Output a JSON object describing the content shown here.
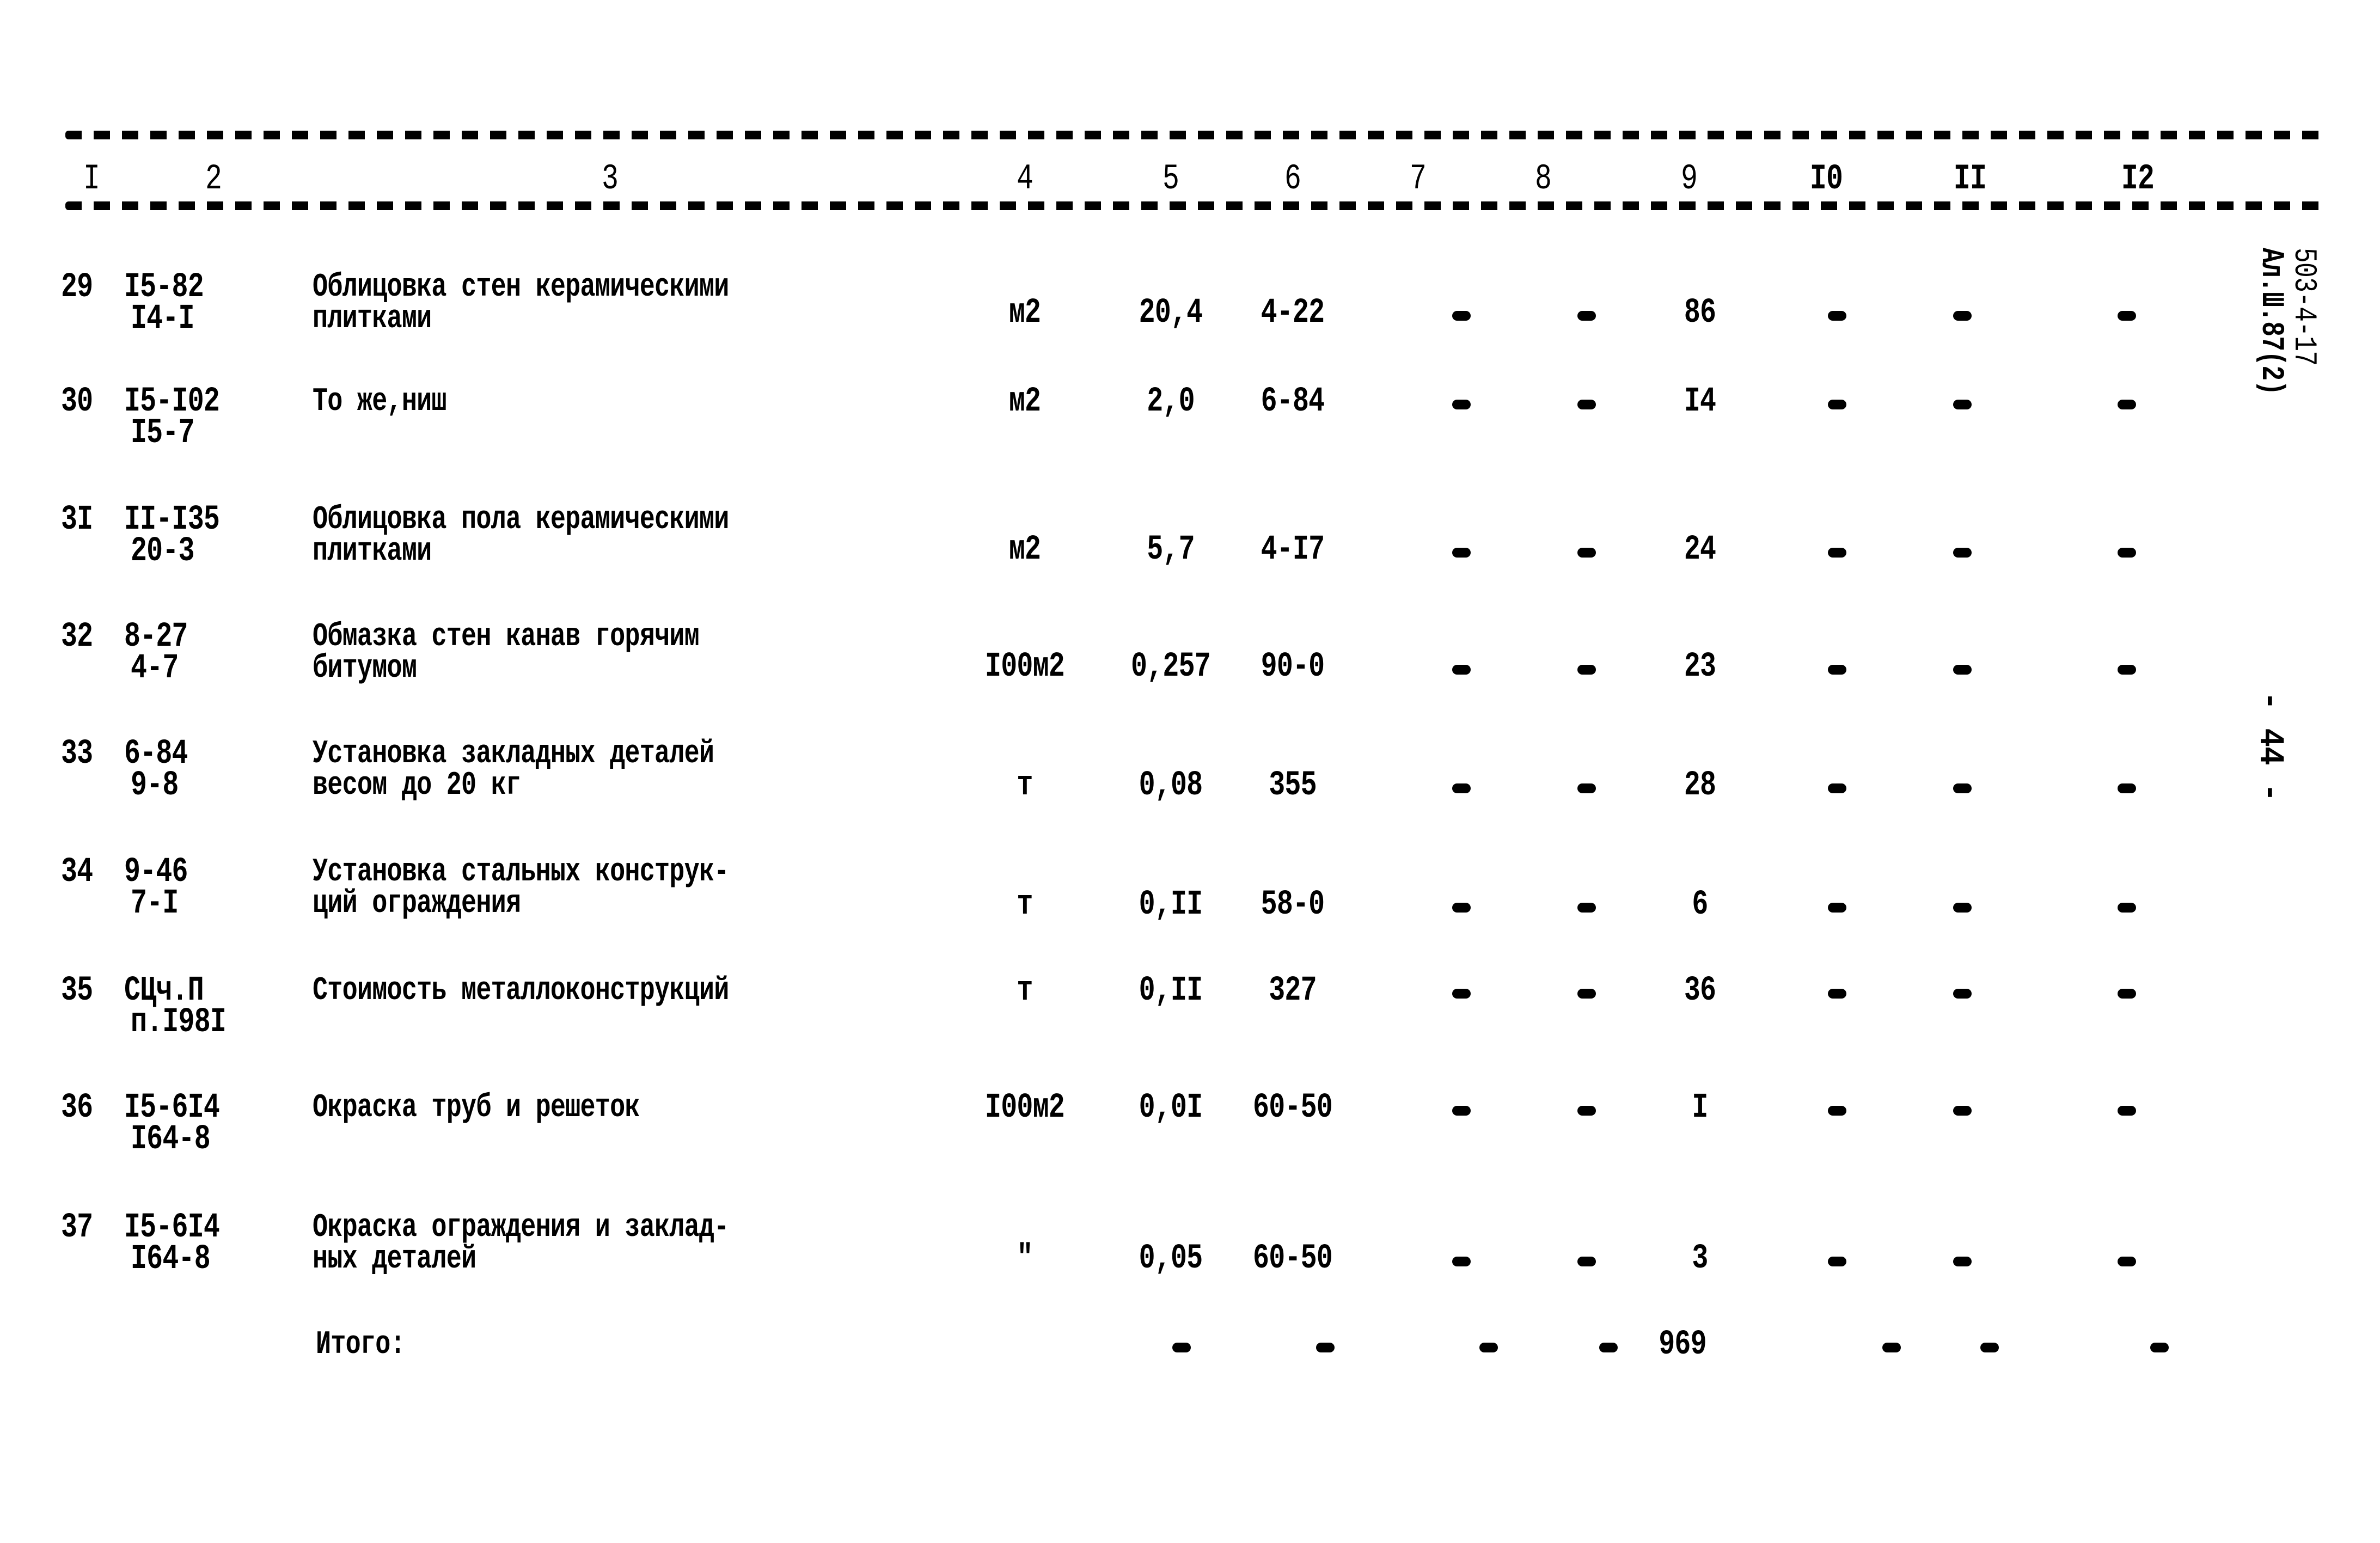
{
  "document": {
    "side_code_line1": "503-4-17",
    "side_code_line2": "Ал.Ш.87(2)",
    "page_number": "- 44 -"
  },
  "table": {
    "column_headers": [
      "I",
      "2",
      "3",
      "4",
      "5",
      "6",
      "7",
      "8",
      "9",
      "I0",
      "II",
      "I2"
    ],
    "rows": [
      {
        "no": "29",
        "code1": "I5-82",
        "code2": "I4-I",
        "desc1": "Облицовка стен керамическими",
        "desc2": "плитками",
        "unit": "м2",
        "qty": "20,4",
        "price": "4-22",
        "c7": "-",
        "c8": "-",
        "c9": "86",
        "c10": "-",
        "c11": "-",
        "c12": "-"
      },
      {
        "no": "30",
        "code1": "I5-I02",
        "code2": "I5-7",
        "desc1": "То же,ниш",
        "desc2": "",
        "unit": "м2",
        "qty": "2,0",
        "price": "6-84",
        "c7": "-",
        "c8": "-",
        "c9": "I4",
        "c10": "-",
        "c11": "-",
        "c12": "-"
      },
      {
        "no": "3I",
        "code1": "II-I35",
        "code2": "20-3",
        "desc1": "Облицовка пола керамическими",
        "desc2": "плитками",
        "unit": "м2",
        "qty": "5,7",
        "price": "4-I7",
        "c7": "-",
        "c8": "-",
        "c9": "24",
        "c10": "-",
        "c11": "-",
        "c12": "-"
      },
      {
        "no": "32",
        "code1": "8-27",
        "code2": "4-7",
        "desc1": "Обмазка стен канав горячим",
        "desc2": "битумом",
        "unit": "I00м2",
        "qty": "0,257",
        "price": "90-0",
        "c7": "-",
        "c8": "-",
        "c9": "23",
        "c10": "-",
        "c11": "-",
        "c12": "-"
      },
      {
        "no": "33",
        "code1": "6-84",
        "code2": "9-8",
        "desc1": "Установка закладных деталей",
        "desc2": "весом до 20 кг",
        "unit": "т",
        "qty": "0,08",
        "price": "355",
        "c7": "-",
        "c8": "-",
        "c9": "28",
        "c10": "-",
        "c11": "-",
        "c12": "-"
      },
      {
        "no": "34",
        "code1": "9-46",
        "code2": "7-I",
        "desc1": "Установка стальных конструк-",
        "desc2": "ций ограждения",
        "unit": "т",
        "qty": "0,II",
        "price": "58-0",
        "c7": "-",
        "c8": "-",
        "c9": "6",
        "c10": "-",
        "c11": "-",
        "c12": "-"
      },
      {
        "no": "35",
        "code1": "СЦч.П",
        "code2": "п.I98I",
        "desc1": "Стоимость металлоконструкций",
        "desc2": "",
        "unit": "т",
        "qty": "0,II",
        "price": "327",
        "c7": "-",
        "c8": "-",
        "c9": "36",
        "c10": "-",
        "c11": "-",
        "c12": "-"
      },
      {
        "no": "36",
        "code1": "I5-6I4",
        "code2": "I64-8",
        "desc1": "Окраска труб и решеток",
        "desc2": "",
        "unit": "I00м2",
        "qty": "0,0I",
        "price": "60-50",
        "c7": "-",
        "c8": "-",
        "c9": "I",
        "c10": "-",
        "c11": "-",
        "c12": "-"
      },
      {
        "no": "37",
        "code1": "I5-6I4",
        "code2": "I64-8",
        "desc1": "Окраска ограждения и заклад-",
        "desc2": "ных деталей",
        "unit": "\"",
        "qty": "0,05",
        "price": "60-50",
        "c7": "-",
        "c8": "-",
        "c9": "3",
        "c10": "-",
        "c11": "-",
        "c12": "-"
      }
    ],
    "total": {
      "label": "Итого:",
      "c5": "-",
      "c6": "-",
      "c7": "-",
      "c8": "-",
      "c9": "969",
      "c10": "-",
      "c11": "-",
      "c12": "-"
    }
  }
}
